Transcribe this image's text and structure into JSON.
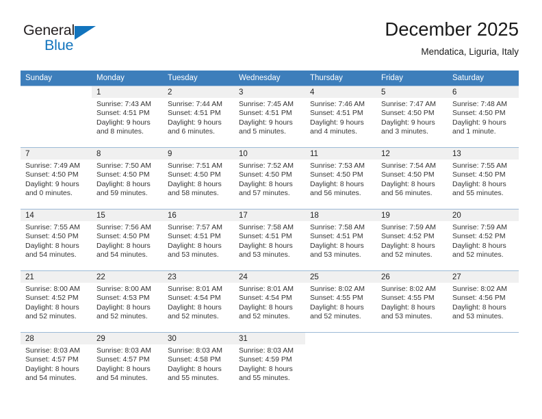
{
  "brand": {
    "name_part1": "General",
    "name_part2": "Blue",
    "triangle_icon": "triangle-icon",
    "accent_color": "#1274bd"
  },
  "header": {
    "title": "December 2025",
    "subtitle": "Mendatica, Liguria, Italy"
  },
  "theme": {
    "header_bg": "#3d7ebb",
    "header_text": "#ffffff",
    "daynum_bg": "#f0f0f0",
    "grid_line": "#9bb9d6"
  },
  "weekday_headers": [
    "Sunday",
    "Monday",
    "Tuesday",
    "Wednesday",
    "Thursday",
    "Friday",
    "Saturday"
  ],
  "weeks": [
    [
      {
        "day": "",
        "sunrise": "",
        "sunset": "",
        "daylight1": "",
        "daylight2": ""
      },
      {
        "day": "1",
        "sunrise": "Sunrise: 7:43 AM",
        "sunset": "Sunset: 4:51 PM",
        "daylight1": "Daylight: 9 hours",
        "daylight2": "and 8 minutes."
      },
      {
        "day": "2",
        "sunrise": "Sunrise: 7:44 AM",
        "sunset": "Sunset: 4:51 PM",
        "daylight1": "Daylight: 9 hours",
        "daylight2": "and 6 minutes."
      },
      {
        "day": "3",
        "sunrise": "Sunrise: 7:45 AM",
        "sunset": "Sunset: 4:51 PM",
        "daylight1": "Daylight: 9 hours",
        "daylight2": "and 5 minutes."
      },
      {
        "day": "4",
        "sunrise": "Sunrise: 7:46 AM",
        "sunset": "Sunset: 4:51 PM",
        "daylight1": "Daylight: 9 hours",
        "daylight2": "and 4 minutes."
      },
      {
        "day": "5",
        "sunrise": "Sunrise: 7:47 AM",
        "sunset": "Sunset: 4:50 PM",
        "daylight1": "Daylight: 9 hours",
        "daylight2": "and 3 minutes."
      },
      {
        "day": "6",
        "sunrise": "Sunrise: 7:48 AM",
        "sunset": "Sunset: 4:50 PM",
        "daylight1": "Daylight: 9 hours",
        "daylight2": "and 1 minute."
      }
    ],
    [
      {
        "day": "7",
        "sunrise": "Sunrise: 7:49 AM",
        "sunset": "Sunset: 4:50 PM",
        "daylight1": "Daylight: 9 hours",
        "daylight2": "and 0 minutes."
      },
      {
        "day": "8",
        "sunrise": "Sunrise: 7:50 AM",
        "sunset": "Sunset: 4:50 PM",
        "daylight1": "Daylight: 8 hours",
        "daylight2": "and 59 minutes."
      },
      {
        "day": "9",
        "sunrise": "Sunrise: 7:51 AM",
        "sunset": "Sunset: 4:50 PM",
        "daylight1": "Daylight: 8 hours",
        "daylight2": "and 58 minutes."
      },
      {
        "day": "10",
        "sunrise": "Sunrise: 7:52 AM",
        "sunset": "Sunset: 4:50 PM",
        "daylight1": "Daylight: 8 hours",
        "daylight2": "and 57 minutes."
      },
      {
        "day": "11",
        "sunrise": "Sunrise: 7:53 AM",
        "sunset": "Sunset: 4:50 PM",
        "daylight1": "Daylight: 8 hours",
        "daylight2": "and 56 minutes."
      },
      {
        "day": "12",
        "sunrise": "Sunrise: 7:54 AM",
        "sunset": "Sunset: 4:50 PM",
        "daylight1": "Daylight: 8 hours",
        "daylight2": "and 56 minutes."
      },
      {
        "day": "13",
        "sunrise": "Sunrise: 7:55 AM",
        "sunset": "Sunset: 4:50 PM",
        "daylight1": "Daylight: 8 hours",
        "daylight2": "and 55 minutes."
      }
    ],
    [
      {
        "day": "14",
        "sunrise": "Sunrise: 7:55 AM",
        "sunset": "Sunset: 4:50 PM",
        "daylight1": "Daylight: 8 hours",
        "daylight2": "and 54 minutes."
      },
      {
        "day": "15",
        "sunrise": "Sunrise: 7:56 AM",
        "sunset": "Sunset: 4:50 PM",
        "daylight1": "Daylight: 8 hours",
        "daylight2": "and 54 minutes."
      },
      {
        "day": "16",
        "sunrise": "Sunrise: 7:57 AM",
        "sunset": "Sunset: 4:51 PM",
        "daylight1": "Daylight: 8 hours",
        "daylight2": "and 53 minutes."
      },
      {
        "day": "17",
        "sunrise": "Sunrise: 7:58 AM",
        "sunset": "Sunset: 4:51 PM",
        "daylight1": "Daylight: 8 hours",
        "daylight2": "and 53 minutes."
      },
      {
        "day": "18",
        "sunrise": "Sunrise: 7:58 AM",
        "sunset": "Sunset: 4:51 PM",
        "daylight1": "Daylight: 8 hours",
        "daylight2": "and 53 minutes."
      },
      {
        "day": "19",
        "sunrise": "Sunrise: 7:59 AM",
        "sunset": "Sunset: 4:52 PM",
        "daylight1": "Daylight: 8 hours",
        "daylight2": "and 52 minutes."
      },
      {
        "day": "20",
        "sunrise": "Sunrise: 7:59 AM",
        "sunset": "Sunset: 4:52 PM",
        "daylight1": "Daylight: 8 hours",
        "daylight2": "and 52 minutes."
      }
    ],
    [
      {
        "day": "21",
        "sunrise": "Sunrise: 8:00 AM",
        "sunset": "Sunset: 4:52 PM",
        "daylight1": "Daylight: 8 hours",
        "daylight2": "and 52 minutes."
      },
      {
        "day": "22",
        "sunrise": "Sunrise: 8:00 AM",
        "sunset": "Sunset: 4:53 PM",
        "daylight1": "Daylight: 8 hours",
        "daylight2": "and 52 minutes."
      },
      {
        "day": "23",
        "sunrise": "Sunrise: 8:01 AM",
        "sunset": "Sunset: 4:54 PM",
        "daylight1": "Daylight: 8 hours",
        "daylight2": "and 52 minutes."
      },
      {
        "day": "24",
        "sunrise": "Sunrise: 8:01 AM",
        "sunset": "Sunset: 4:54 PM",
        "daylight1": "Daylight: 8 hours",
        "daylight2": "and 52 minutes."
      },
      {
        "day": "25",
        "sunrise": "Sunrise: 8:02 AM",
        "sunset": "Sunset: 4:55 PM",
        "daylight1": "Daylight: 8 hours",
        "daylight2": "and 52 minutes."
      },
      {
        "day": "26",
        "sunrise": "Sunrise: 8:02 AM",
        "sunset": "Sunset: 4:55 PM",
        "daylight1": "Daylight: 8 hours",
        "daylight2": "and 53 minutes."
      },
      {
        "day": "27",
        "sunrise": "Sunrise: 8:02 AM",
        "sunset": "Sunset: 4:56 PM",
        "daylight1": "Daylight: 8 hours",
        "daylight2": "and 53 minutes."
      }
    ],
    [
      {
        "day": "28",
        "sunrise": "Sunrise: 8:03 AM",
        "sunset": "Sunset: 4:57 PM",
        "daylight1": "Daylight: 8 hours",
        "daylight2": "and 54 minutes."
      },
      {
        "day": "29",
        "sunrise": "Sunrise: 8:03 AM",
        "sunset": "Sunset: 4:57 PM",
        "daylight1": "Daylight: 8 hours",
        "daylight2": "and 54 minutes."
      },
      {
        "day": "30",
        "sunrise": "Sunrise: 8:03 AM",
        "sunset": "Sunset: 4:58 PM",
        "daylight1": "Daylight: 8 hours",
        "daylight2": "and 55 minutes."
      },
      {
        "day": "31",
        "sunrise": "Sunrise: 8:03 AM",
        "sunset": "Sunset: 4:59 PM",
        "daylight1": "Daylight: 8 hours",
        "daylight2": "and 55 minutes."
      },
      {
        "day": "",
        "sunrise": "",
        "sunset": "",
        "daylight1": "",
        "daylight2": ""
      },
      {
        "day": "",
        "sunrise": "",
        "sunset": "",
        "daylight1": "",
        "daylight2": ""
      },
      {
        "day": "",
        "sunrise": "",
        "sunset": "",
        "daylight1": "",
        "daylight2": ""
      }
    ]
  ]
}
